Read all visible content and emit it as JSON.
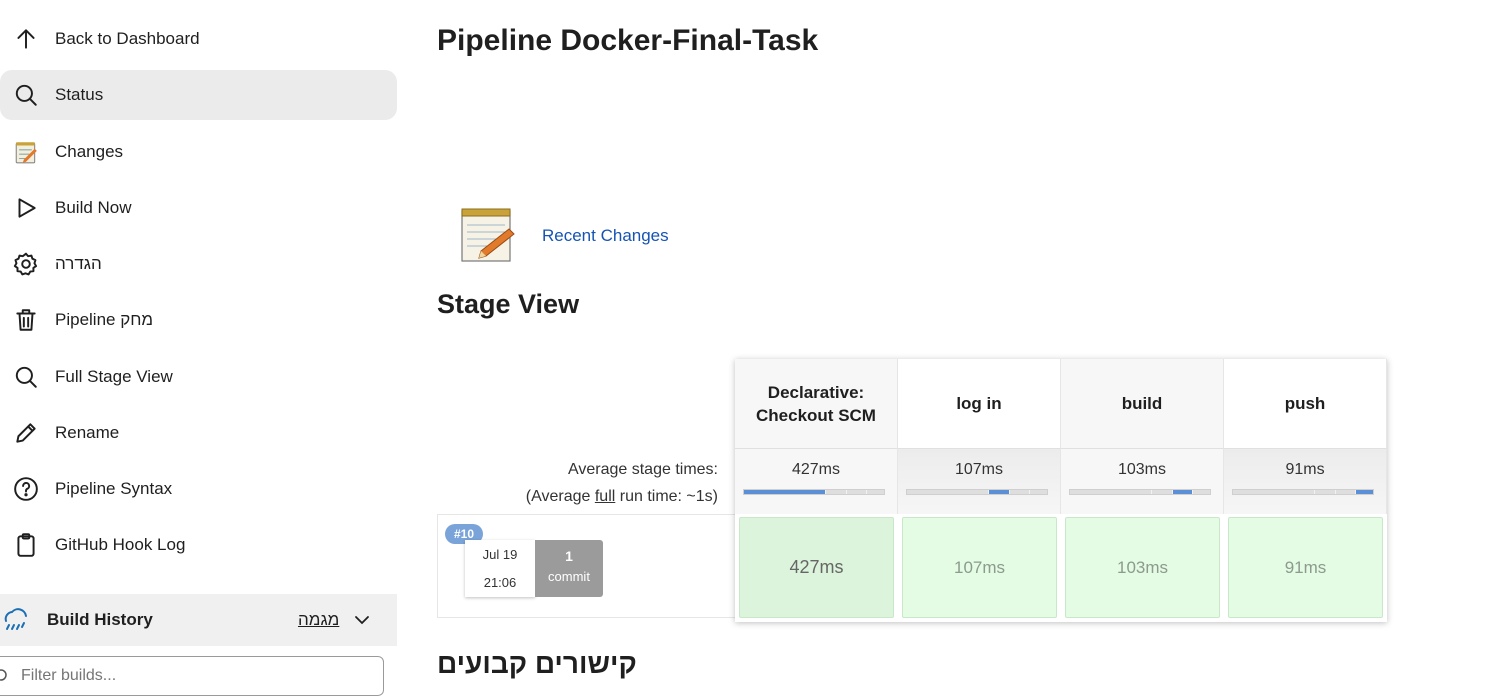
{
  "sidebar": {
    "items": [
      {
        "label": "Back to Dashboard",
        "icon": "arrow-up-icon"
      },
      {
        "label": "Status",
        "icon": "search-icon"
      },
      {
        "label": "Changes",
        "icon": "notepad-icon"
      },
      {
        "label": "Build Now",
        "icon": "play-icon"
      },
      {
        "label": "הגדרה",
        "icon": "gear-icon"
      },
      {
        "label": "Pipeline מחק",
        "icon": "trash-icon"
      },
      {
        "label": "Full Stage View",
        "icon": "search-icon"
      },
      {
        "label": "Rename",
        "icon": "pencil-icon"
      },
      {
        "label": "Pipeline Syntax",
        "icon": "help-icon"
      },
      {
        "label": "GitHub Hook Log",
        "icon": "clipboard-icon"
      }
    ],
    "build_history": {
      "title": "Build History",
      "trend_label": "מגמה"
    },
    "filter": {
      "placeholder": "Filter builds..."
    }
  },
  "main": {
    "title": "Pipeline Docker-Final-Task",
    "recent_changes": "Recent Changes",
    "stage_view_title": "Stage View",
    "permalinks_title": "קישורים קבועים"
  },
  "stage_view": {
    "avg_label": "Average stage times:",
    "avg_full_prefix": "(Average ",
    "avg_full_link": "full",
    "avg_full_suffix": " run time: ~1s)",
    "stages": [
      {
        "name": "Declarative: Checkout SCM",
        "avg": "427ms",
        "share": 0.58
      },
      {
        "name": "log in",
        "avg": "107ms",
        "share": 0.15
      },
      {
        "name": "build",
        "avg": "103ms",
        "share": 0.14
      },
      {
        "name": "push",
        "avg": "91ms",
        "share": 0.13
      }
    ],
    "builds": [
      {
        "number": "#10",
        "date": "Jul 19",
        "time": "21:06",
        "commits": "1",
        "commit_word": "commit",
        "stage_times": [
          "427ms",
          "107ms",
          "103ms",
          "91ms"
        ]
      }
    ]
  },
  "colors": {
    "link": "#1654b4",
    "success_cell": "#e4fbe4",
    "bar_fill": "#5b8fd6",
    "badge": "#7aa4d9",
    "active_item_bg": "#ebebeb"
  }
}
